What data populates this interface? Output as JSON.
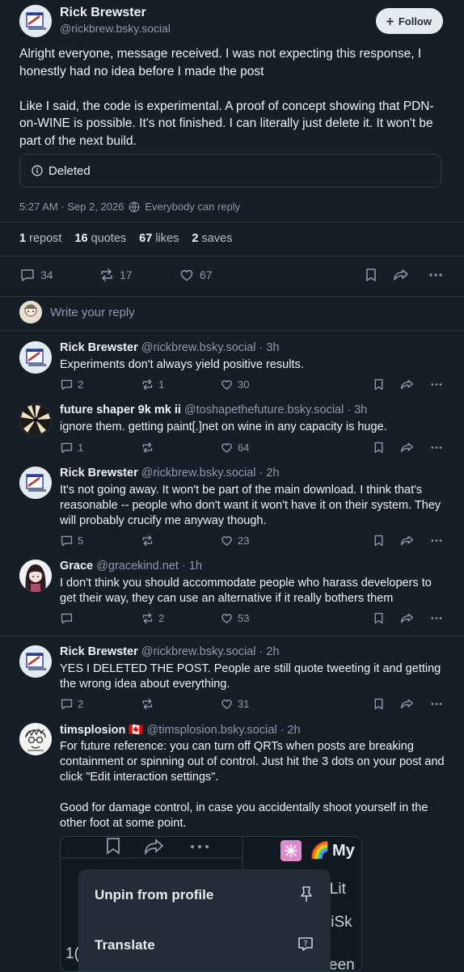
{
  "post": {
    "author_name": "Rick Brewster",
    "author_handle": "@rickbrew.bsky.social",
    "follow_label": "Follow",
    "text": "Alright everyone, message received. I was not expecting this response, I honestly had no idea before I made the post\n\nLike I said, the code is experimental. A proof of concept showing that PDN-on-WINE is possible. It's not finished. I can literally just delete it. It won't be part of the next build.",
    "embed_status": "Deleted",
    "timestamp": "5:27 AM · Sep 2, 2026",
    "reply_setting": "Everybody can reply",
    "stats": {
      "reposts_count": "1",
      "reposts_label": "repost",
      "quotes_count": "16",
      "quotes_label": "quotes",
      "likes_count": "67",
      "likes_label": "likes",
      "saves_count": "2",
      "saves_label": "saves"
    },
    "actions": {
      "replies": "34",
      "reposts": "17",
      "likes": "67"
    }
  },
  "reply_placeholder": "Write your reply",
  "replies": [
    {
      "name": "Rick Brewster",
      "handle": "@rickbrew.bsky.social",
      "time": "· 3h",
      "text": "Experiments don't always yield positive results.",
      "replies": "2",
      "reposts": "1",
      "likes": "30"
    },
    {
      "name": "future shaper 9k mk ii",
      "handle": "@toshapethefuture.bsky.social",
      "time": "· 3h",
      "text": "ignore them. getting paint[.]net on wine in any capacity is huge.",
      "replies": "1",
      "reposts": "",
      "likes": "64"
    },
    {
      "name": "Rick Brewster",
      "handle": "@rickbrew.bsky.social",
      "time": "· 2h",
      "text": "It's not going away. It won't be part of the main download. I think that's reasonable -- people who don't want it won't have it on their system. They will probably crucify me anyway though.",
      "replies": "5",
      "reposts": "",
      "likes": "23"
    },
    {
      "name": "Grace",
      "handle": "@gracekind.net",
      "time": "· 1h",
      "text": "I don't think you should accommodate people who harass developers to get their way, they can use an alternative if it really bothers them",
      "replies": "",
      "reposts": "2",
      "likes": "53"
    },
    {
      "name": "Rick Brewster",
      "handle": "@rickbrew.bsky.social",
      "time": "· 2h",
      "text": "YES I DELETED THE POST. People are still quote tweeting it and getting the wrong idea about everything.",
      "replies": "2",
      "reposts": "",
      "likes": "31"
    },
    {
      "name": "timsplosion",
      "flag": "🇨🇦",
      "handle": "@timsplosion.bsky.social",
      "time": "· 2h",
      "text": "For future reference: you can turn off QRTs when posts are breaking containment or spinning out of control. Just hit the 3 dots on your post and click \"Edit interaction settings\".\n\nGood for damage control, in case you accidentally shoot yourself in the other foot at some point."
    }
  ],
  "embed_image": {
    "menu_item_1": "Unpin from profile",
    "menu_item_2": "Translate",
    "side_text_1": "My",
    "side_text_2": "y Lit",
    "side_text_3": "liSk",
    "side_text_4": "een",
    "side_text_5": "1("
  },
  "colors": {
    "background": "#161e27",
    "muted": "#8e9bab",
    "divider": "#2a3440"
  }
}
